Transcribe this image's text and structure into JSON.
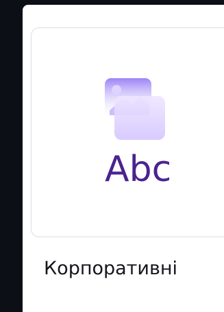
{
  "template": {
    "name": "Корпоративні",
    "thumbnail_text": "Abc",
    "thumbnail_icon": "image-icon"
  },
  "colors": {
    "background": "#0d0f16",
    "panel": "#ffffff",
    "card_border": "#dddde2",
    "accent_purple": "#4a2390",
    "light_purple": "#d7c9ff"
  }
}
